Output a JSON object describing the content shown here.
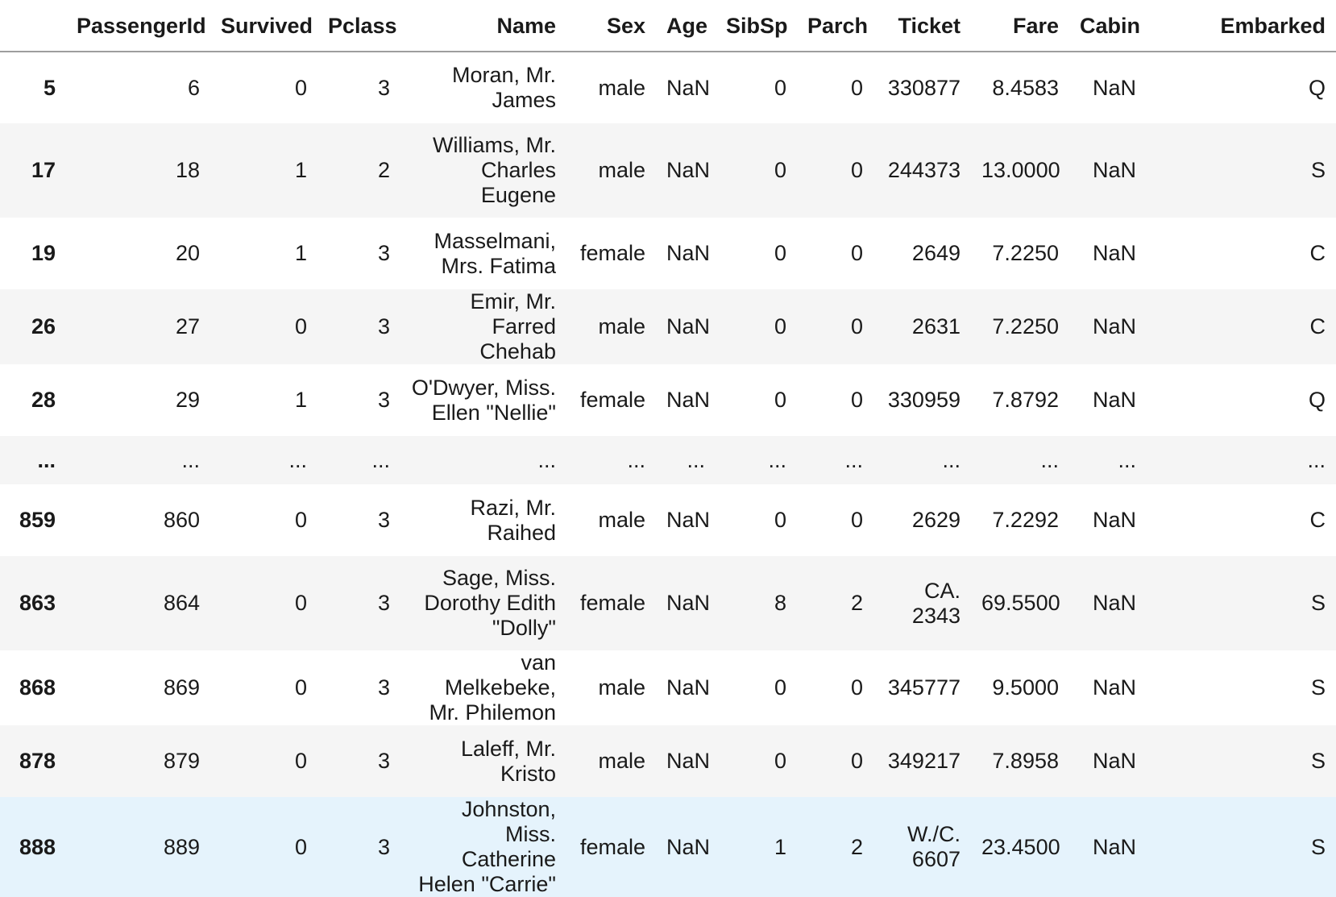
{
  "table": {
    "columns": [
      "",
      "PassengerId",
      "Survived",
      "Pclass",
      "Name",
      "Sex",
      "Age",
      "SibSp",
      "Parch",
      "Ticket",
      "Fare",
      "Cabin",
      "Embarked"
    ],
    "rows": [
      {
        "index": "5",
        "cells": [
          "6",
          "0",
          "3",
          "Moran, Mr.\nJames",
          "male",
          "NaN",
          "0",
          "0",
          "330877",
          "8.4583",
          "NaN",
          "Q"
        ]
      },
      {
        "index": "17",
        "cells": [
          "18",
          "1",
          "2",
          "Williams, Mr.\nCharles\nEugene",
          "male",
          "NaN",
          "0",
          "0",
          "244373",
          "13.0000",
          "NaN",
          "S"
        ]
      },
      {
        "index": "19",
        "cells": [
          "20",
          "1",
          "3",
          "Masselmani,\nMrs. Fatima",
          "female",
          "NaN",
          "0",
          "0",
          "2649",
          "7.2250",
          "NaN",
          "C"
        ]
      },
      {
        "index": "26",
        "cells": [
          "27",
          "0",
          "3",
          "Emir, Mr.\nFarred Chehab",
          "male",
          "NaN",
          "0",
          "0",
          "2631",
          "7.2250",
          "NaN",
          "C"
        ]
      },
      {
        "index": "28",
        "cells": [
          "29",
          "1",
          "3",
          "O'Dwyer, Miss.\nEllen \"Nellie\"",
          "female",
          "NaN",
          "0",
          "0",
          "330959",
          "7.8792",
          "NaN",
          "Q"
        ]
      },
      {
        "index": "...",
        "cells": [
          "...",
          "...",
          "...",
          "...",
          "...",
          "...",
          "...",
          "...",
          "...",
          "...",
          "...",
          "..."
        ]
      },
      {
        "index": "859",
        "cells": [
          "860",
          "0",
          "3",
          "Razi, Mr.\nRaihed",
          "male",
          "NaN",
          "0",
          "0",
          "2629",
          "7.2292",
          "NaN",
          "C"
        ]
      },
      {
        "index": "863",
        "cells": [
          "864",
          "0",
          "3",
          "Sage, Miss.\nDorothy Edith\n\"Dolly\"",
          "female",
          "NaN",
          "8",
          "2",
          "CA.\n2343",
          "69.5500",
          "NaN",
          "S"
        ]
      },
      {
        "index": "868",
        "cells": [
          "869",
          "0",
          "3",
          "van Melkebeke,\nMr. Philemon",
          "male",
          "NaN",
          "0",
          "0",
          "345777",
          "9.5000",
          "NaN",
          "S"
        ]
      },
      {
        "index": "878",
        "cells": [
          "879",
          "0",
          "3",
          "Laleff, Mr.\nKristo",
          "male",
          "NaN",
          "0",
          "0",
          "349217",
          "7.8958",
          "NaN",
          "S"
        ]
      },
      {
        "index": "888",
        "cells": [
          "889",
          "0",
          "3",
          "Johnston,\nMiss. Catherine\nHelen \"Carrie\"",
          "female",
          "NaN",
          "1",
          "2",
          "W./C.\n6607",
          "23.4500",
          "NaN",
          "S"
        ]
      }
    ]
  }
}
